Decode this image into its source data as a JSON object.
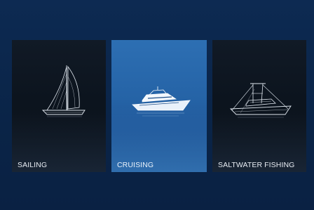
{
  "activity_menu": {
    "cards": [
      {
        "label": "SAILING",
        "icon": "sailboat-icon",
        "selected": false
      },
      {
        "label": "CRUISING",
        "icon": "motor-yacht-icon",
        "selected": true
      },
      {
        "label": "SALTWATER FISHING",
        "icon": "sportfishing-boat-icon",
        "selected": false
      }
    ]
  },
  "colors": {
    "background": "#0a2447",
    "card_dark": "#0c141e",
    "card_selected": "#2563a6",
    "label_text": "#e8edf3"
  }
}
